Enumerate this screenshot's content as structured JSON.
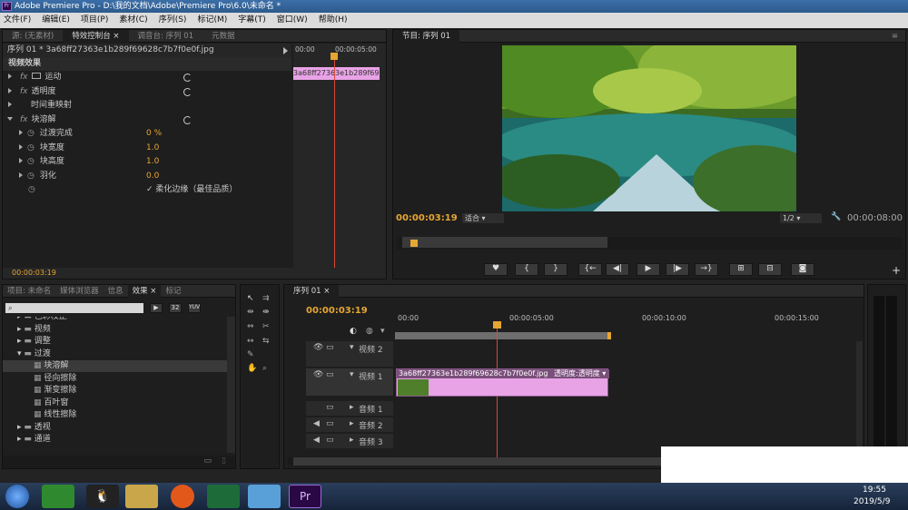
{
  "window": {
    "title": "Adobe Premiere Pro - D:\\我的文档\\Adobe\\Premiere Pro\\6.0\\未命名 *",
    "logo": "Pr"
  },
  "menu": [
    "文件(F)",
    "编辑(E)",
    "项目(P)",
    "素材(C)",
    "序列(S)",
    "标记(M)",
    "字幕(T)",
    "窗口(W)",
    "帮助(H)"
  ],
  "effect_controls": {
    "tabs": [
      "源: (无素材)",
      "特效控制台 ×",
      "调音台: 序列 01",
      "元数据"
    ],
    "clip_path": "序列 01 * 3a68ff27363e1b289f69628c7b7f0e0f.jpg",
    "mini_times": [
      "00:00",
      "00:00:05:00"
    ],
    "mini_clip": "3a68ff27363e1b289f6962",
    "section": "视频效果",
    "effects": [
      "运动",
      "透明度",
      "时间重映射",
      "块溶解"
    ],
    "params": [
      {
        "name": "过渡完成",
        "value": "0 %"
      },
      {
        "name": "块宽度",
        "value": "1.0"
      },
      {
        "name": "块高度",
        "value": "1.0"
      },
      {
        "name": "羽化",
        "value": "0.0"
      }
    ],
    "checkbox_label": "柔化边缘（最佳品质）",
    "bottom_time": "00:00:03:19"
  },
  "program": {
    "tab": "节目: 序列 01",
    "timecode": "00:00:03:19",
    "fit": "适合",
    "quality": "1/2",
    "duration": "00:00:08:00"
  },
  "project": {
    "tabs": [
      "项目: 未命名",
      "媒体浏览器",
      "信息",
      "效果 ×",
      "标记"
    ],
    "badges": [
      "32",
      "YUV"
    ],
    "tree": [
      {
        "label": "色彩校正",
        "level": 1,
        "folder": true
      },
      {
        "label": "视频",
        "level": 1,
        "folder": true
      },
      {
        "label": "调整",
        "level": 1,
        "folder": true
      },
      {
        "label": "过渡",
        "level": 1,
        "folder": true,
        "open": true
      },
      {
        "label": "块溶解",
        "level": 2,
        "selected": true
      },
      {
        "label": "径向擦除",
        "level": 2
      },
      {
        "label": "渐变擦除",
        "level": 2
      },
      {
        "label": "百叶窗",
        "level": 2
      },
      {
        "label": "线性擦除",
        "level": 2
      },
      {
        "label": "透视",
        "level": 1,
        "folder": true
      },
      {
        "label": "通道",
        "level": 1,
        "folder": true
      }
    ]
  },
  "timeline": {
    "tab": "序列 01 ×",
    "timecode": "00:00:03:19",
    "ruler": [
      "00:00",
      "00:00:05:00",
      "00:00:10:00",
      "00:00:15:00"
    ],
    "tracks": [
      "视频 2",
      "视频 1",
      "音频 1",
      "音频 2",
      "音频 3"
    ],
    "clip_name": "3a68ff27363e1b289f69628c7b7f0e0f.jpg",
    "clip_fx": "透明度:透明度 ▾"
  },
  "taskbar": {
    "time": "19:55",
    "date": "2019/5/9",
    "pr": "Pr"
  }
}
